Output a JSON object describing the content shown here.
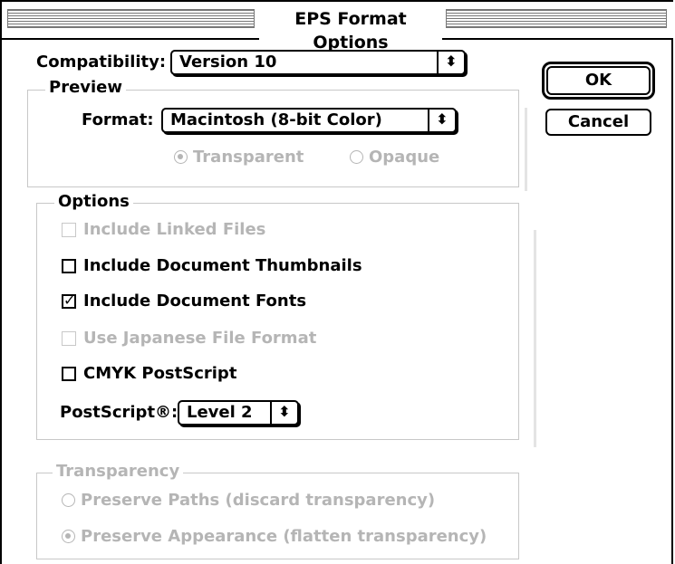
{
  "window": {
    "title": "EPS Format Options"
  },
  "compatibility": {
    "label": "Compatibility:",
    "value": "Version 10"
  },
  "preview": {
    "group_title": "Preview",
    "format_label": "Format:",
    "format_value": "Macintosh (8-bit Color)",
    "transparent_label": "Transparent",
    "opaque_label": "Opaque",
    "selected": "Transparent"
  },
  "options": {
    "group_title": "Options",
    "include_linked_files": {
      "label": "Include Linked Files",
      "checked": false,
      "enabled": false
    },
    "include_document_thumbnails": {
      "label": "Include Document Thumbnails",
      "checked": false,
      "enabled": true
    },
    "include_document_fonts": {
      "label": "Include Document Fonts",
      "checked": true,
      "enabled": true
    },
    "use_japanese_file_format": {
      "label": "Use Japanese File Format",
      "checked": false,
      "enabled": false
    },
    "cmyk_postscript": {
      "label": "CMYK PostScript",
      "checked": false,
      "enabled": true
    },
    "postscript_label": "PostScript®:",
    "postscript_value": "Level 2"
  },
  "transparency": {
    "group_title": "Transparency",
    "preserve_paths_label": "Preserve Paths (discard transparency)",
    "preserve_appearance_label": "Preserve Appearance (flatten transparency)",
    "selected": "Preserve Appearance (flatten transparency)"
  },
  "buttons": {
    "ok_label": "OK",
    "cancel_label": "Cancel"
  },
  "icons": {
    "popup_arrow": "up-down-arrows-icon"
  },
  "colors": {
    "disabled_text": "#b5b5b5",
    "group_border": "#c8c8c8"
  }
}
